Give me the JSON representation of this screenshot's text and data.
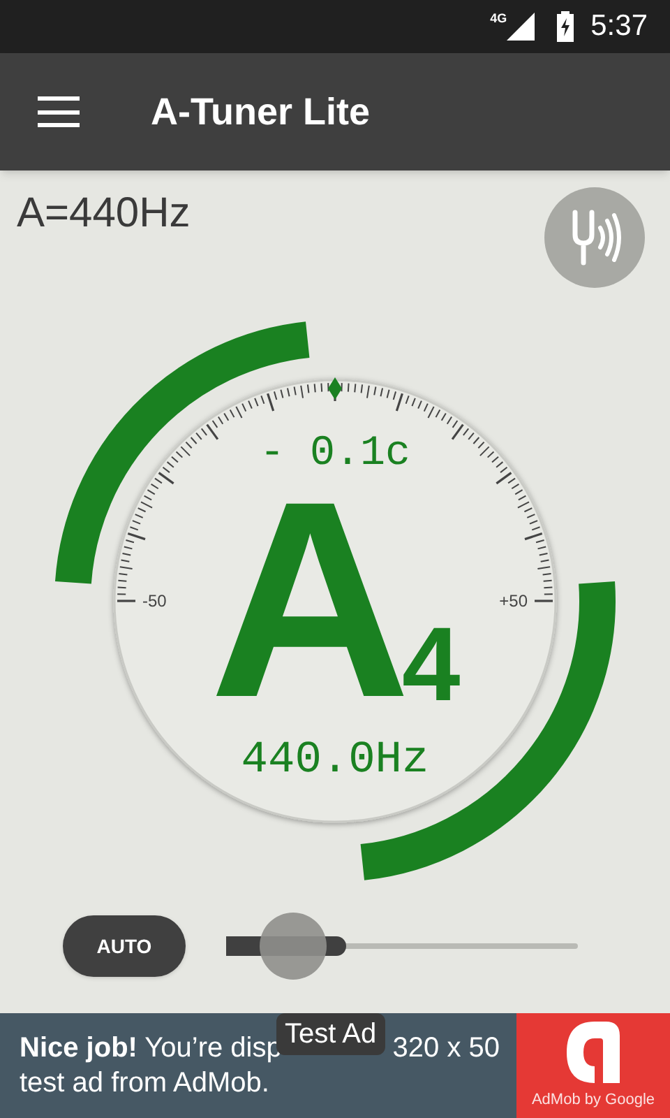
{
  "status_bar": {
    "network": "4G",
    "time": "5:37"
  },
  "app_bar": {
    "title": "A-Tuner Lite"
  },
  "reference": "A=440Hz",
  "gauge": {
    "cents": "- 0.1c",
    "scale_min": "-50",
    "scale_max": "+50",
    "note": "A",
    "octave": "4",
    "frequency": "440.0Hz"
  },
  "controls": {
    "mode_button": "AUTO",
    "slider": {
      "level": 0.34
    }
  },
  "ad": {
    "badge": "Test Ad",
    "line_1_start": "**Nice job!** You’re disp",
    "line_1_end": "320 x 50",
    "line_2": "test ad from AdMob.",
    "brand": "AdMob by Google"
  }
}
